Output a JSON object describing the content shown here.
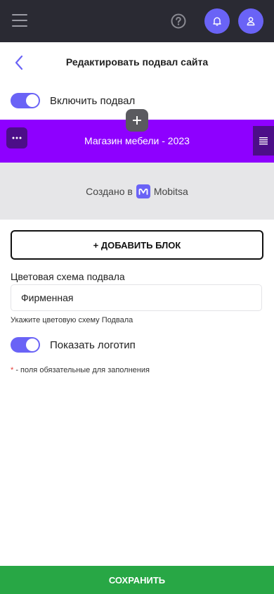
{
  "header": {
    "title": "Редактировать подвал сайта"
  },
  "enable_footer": {
    "label": "Включить подвал",
    "checked": true
  },
  "footer_preview": {
    "title": "Магазин мебели - 2023",
    "credits_prefix": "Создано в",
    "brand": "Mobitsa",
    "brand_letter": "m"
  },
  "add_block_label": "+ ДОБАВИТЬ БЛОК",
  "color_scheme": {
    "label": "Цветовая схема подвала",
    "value": "Фирменная",
    "hint": "Укажите цветовую схему Подвала"
  },
  "show_logo": {
    "label": "Показать логотип",
    "checked": true
  },
  "required_note": {
    "star": "*",
    "text": " - поля обязательные для заполнения"
  },
  "save_label": "СОХРАНИТЬ",
  "colors": {
    "topbar": "#2a2a33",
    "accent": "#6a63f6",
    "footer_bar": "#8e00ff",
    "save": "#28a745"
  }
}
